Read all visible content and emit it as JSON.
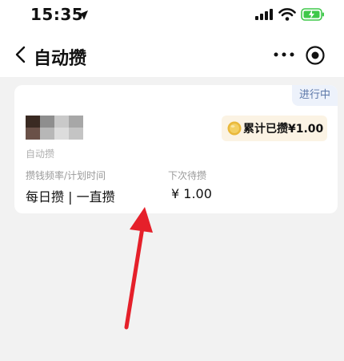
{
  "status_bar": {
    "time": "15:35",
    "icons": [
      "location-arrow-icon",
      "signal-bars-icon",
      "wifi-icon",
      "battery-charging-icon"
    ]
  },
  "nav": {
    "title": "自动攒",
    "back_icon": "chevron-left-icon",
    "more_icon": "more-dots-icon",
    "target_icon": "target-icon"
  },
  "card": {
    "status_badge": "进行中",
    "plan_name": "自动攒",
    "total_saved": "累计已攒¥1.00",
    "frequency_label": "攒钱频率/计划时间",
    "frequency_value": "每日攒 | 一直攒",
    "next_label": "下次待攒",
    "next_value": "¥ 1.00"
  },
  "colors": {
    "page_bg": "#f2f2f2",
    "badge_bg": "#edf2fb",
    "badge_text": "#5b77a8",
    "pill_bg": "#fbf3e4",
    "coin": "#e9b83a",
    "battery": "#3fc84a",
    "arrow": "#e5202a"
  }
}
